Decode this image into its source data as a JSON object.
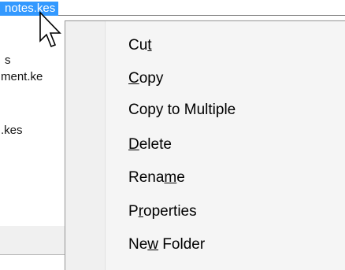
{
  "file_list": {
    "selected_name": "notes.kes",
    "items": [
      "s",
      "ment.ke",
      ".kes"
    ]
  },
  "context_menu": {
    "items": [
      {
        "pre": "Cu",
        "acc": "t",
        "post": ""
      },
      {
        "pre": "",
        "acc": "C",
        "post": "opy"
      },
      {
        "pre": "Copy to Multiple",
        "acc": "",
        "post": ""
      },
      {
        "pre": "",
        "acc": "D",
        "post": "elete"
      },
      {
        "pre": "Rena",
        "acc": "m",
        "post": "e"
      },
      {
        "pre": "P",
        "acc": "r",
        "post": "operties"
      },
      {
        "pre": "Ne",
        "acc": "w",
        "post": " Folder"
      }
    ]
  },
  "cursor": {
    "icon": "arrow-pointer-icon"
  },
  "colors": {
    "selection": "#3399ff",
    "menu_bg": "#f5f5f5"
  }
}
